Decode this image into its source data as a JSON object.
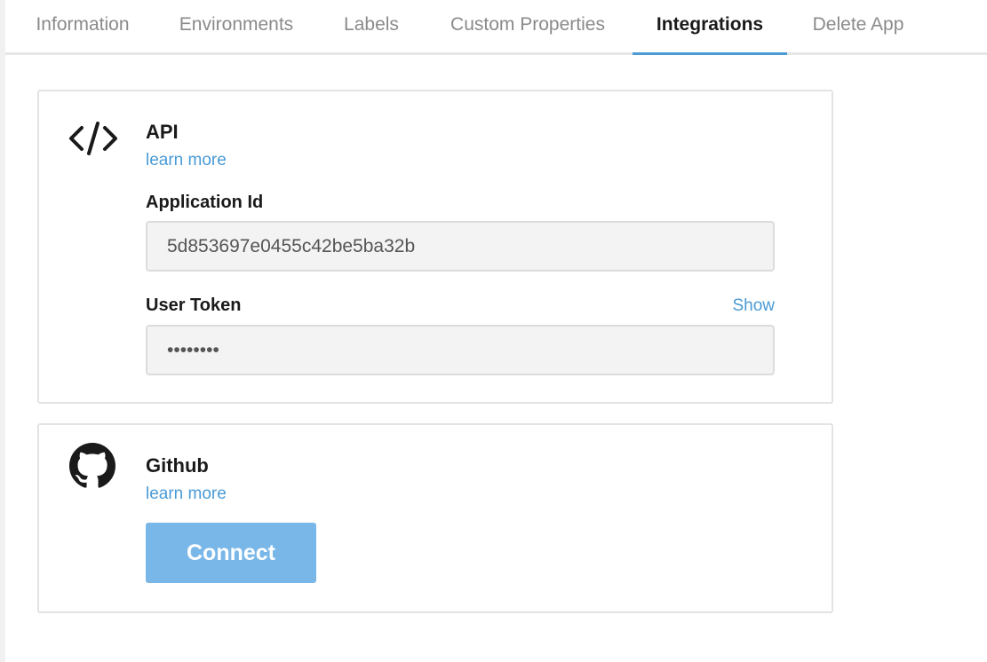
{
  "tabs": [
    {
      "label": "Information"
    },
    {
      "label": "Environments"
    },
    {
      "label": "Labels"
    },
    {
      "label": "Custom Properties"
    },
    {
      "label": "Integrations",
      "active": true
    },
    {
      "label": "Delete App"
    }
  ],
  "api_card": {
    "icon": "code-icon",
    "title": "API",
    "learn_more": "learn more",
    "application_id_label": "Application Id",
    "application_id_value": "5d853697e0455c42be5ba32b",
    "user_token_label": "User Token",
    "show_label": "Show",
    "user_token_value": "••••••••"
  },
  "github_card": {
    "icon": "github-icon",
    "title": "Github",
    "learn_more": "learn more",
    "connect_label": "Connect"
  },
  "colors": {
    "accent": "#4a9bd6",
    "button": "#7ab7e9",
    "border": "#e3e3e3",
    "field_bg": "#f3f3f3"
  }
}
